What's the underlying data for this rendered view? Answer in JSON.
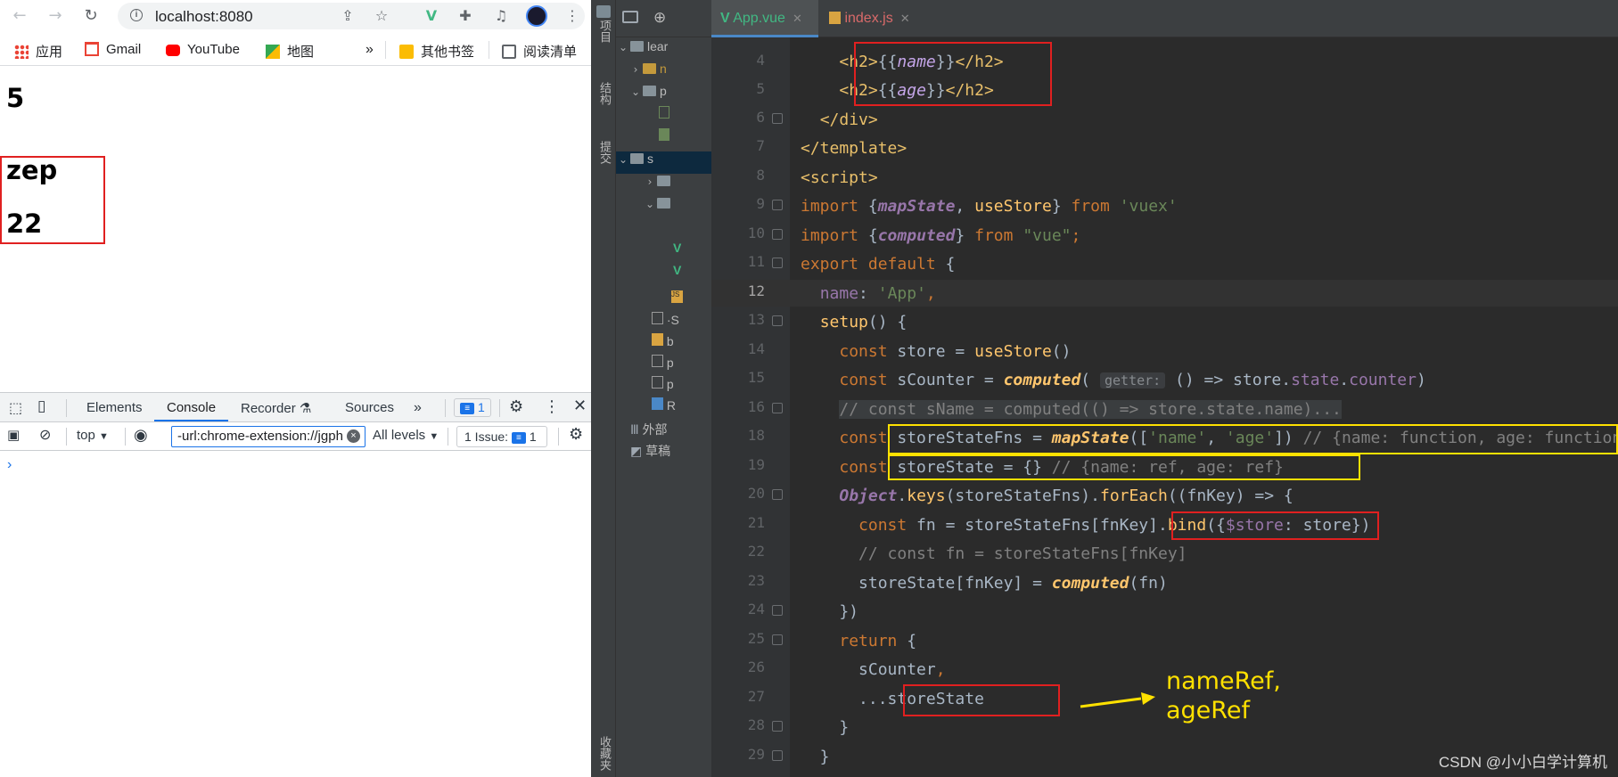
{
  "browser": {
    "url": "localhost:8080",
    "bookmarks": [
      "应用",
      "Gmail",
      "YouTube",
      "地图",
      "»",
      "其他书签",
      "阅读清单"
    ],
    "page": {
      "counter": "5",
      "name": "zep",
      "age": "22"
    },
    "devtools": {
      "tabs": [
        "Elements",
        "Console",
        "Recorder",
        "Sources"
      ],
      "active_tab": "Console",
      "issue_badge": "1",
      "context": "top",
      "filter_value": "-url:chrome-extension://jgph",
      "levels": "All levels",
      "issues_label": "1 Issue:",
      "issues_count": "1",
      "prompt": "›"
    }
  },
  "ide": {
    "side_labels": [
      "项目",
      "结构",
      "提交",
      "收藏夹"
    ],
    "tree": [
      "lear",
      "n",
      "p",
      "s",
      "·S",
      "b",
      "p",
      "p",
      "R",
      "外部",
      "草稿"
    ],
    "tabs": [
      {
        "label": "App.vue",
        "active": true
      },
      {
        "label": "index.js",
        "active": false
      }
    ],
    "current_line": "12",
    "lines": [
      "4",
      "5",
      "6",
      "7",
      "8",
      "9",
      "10",
      "11",
      "12",
      "13",
      "14",
      "15",
      "16",
      "18",
      "19",
      "20",
      "21",
      "22",
      "23",
      "24",
      "25",
      "26",
      "27",
      "28",
      "29"
    ],
    "hint_getter": "getter:",
    "annotation": [
      "nameRef,",
      "ageRef"
    ]
  },
  "watermark": "CSDN @小小白学计算机",
  "colors": {
    "highlight_red": "#e02020",
    "highlight_yellow": "#ffe100",
    "editor_bg": "#2b2b2b"
  }
}
